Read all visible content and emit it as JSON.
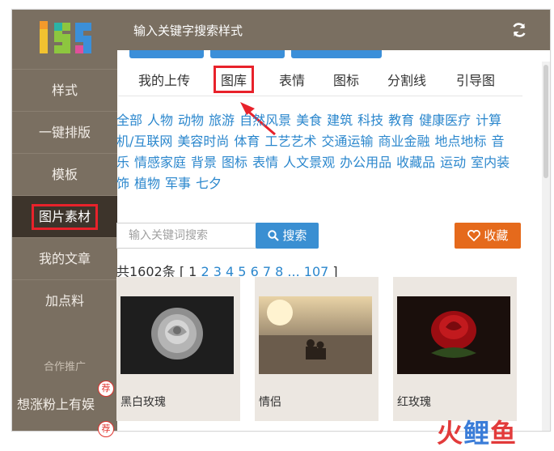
{
  "sidebar": {
    "logo_text": "135",
    "items": [
      {
        "label": "样式"
      },
      {
        "label": "一键排版"
      },
      {
        "label": "模板"
      },
      {
        "label": "图片素材"
      },
      {
        "label": "我的文章"
      },
      {
        "label": "加点料"
      }
    ],
    "section_label": "合作推广",
    "promo_label": "想涨粉上有娱",
    "promo_badge": "荐"
  },
  "header": {
    "title": "输入关键字搜索样式",
    "refresh_icon": "refresh-icon"
  },
  "tabs": [
    {
      "label": "我的上传"
    },
    {
      "label": "图库"
    },
    {
      "label": "表情"
    },
    {
      "label": "图标"
    },
    {
      "label": "分割线"
    },
    {
      "label": "引导图"
    }
  ],
  "tags": [
    "全部",
    "人物",
    "动物",
    "旅游",
    "自然风景",
    "美食",
    "建筑",
    "科技",
    "教育",
    "健康医疗",
    "计算机/互联网",
    "美容时尚",
    "体育",
    "工艺艺术",
    "交通运输",
    "商业金融",
    "地点地标",
    "音乐",
    "情感家庭",
    "背景",
    "图标",
    "表情",
    "人文景观",
    "办公用品",
    "收藏品",
    "运动",
    "室内装饰",
    "植物",
    "军事",
    "七夕"
  ],
  "search": {
    "placeholder": "输入关键词搜索",
    "button_label": "搜索",
    "fav_label": "收藏"
  },
  "pager": {
    "total": "共1602条",
    "open": "[",
    "current": "1",
    "pages": [
      "2",
      "3",
      "4",
      "5",
      "6",
      "7",
      "8"
    ],
    "ellipsis": "...",
    "last": "107",
    "close": "]"
  },
  "cards": [
    {
      "caption": "黑白玫瑰"
    },
    {
      "caption": "情侣"
    },
    {
      "caption": "红玫瑰"
    }
  ],
  "watermark": {
    "part1": "火",
    "part2": "鲤",
    "part3": "鱼"
  },
  "colors": {
    "sidebar": "#7a6f61",
    "accent": "#3a8fd2",
    "highlight": "#e8222b",
    "fav": "#e56a1c"
  }
}
